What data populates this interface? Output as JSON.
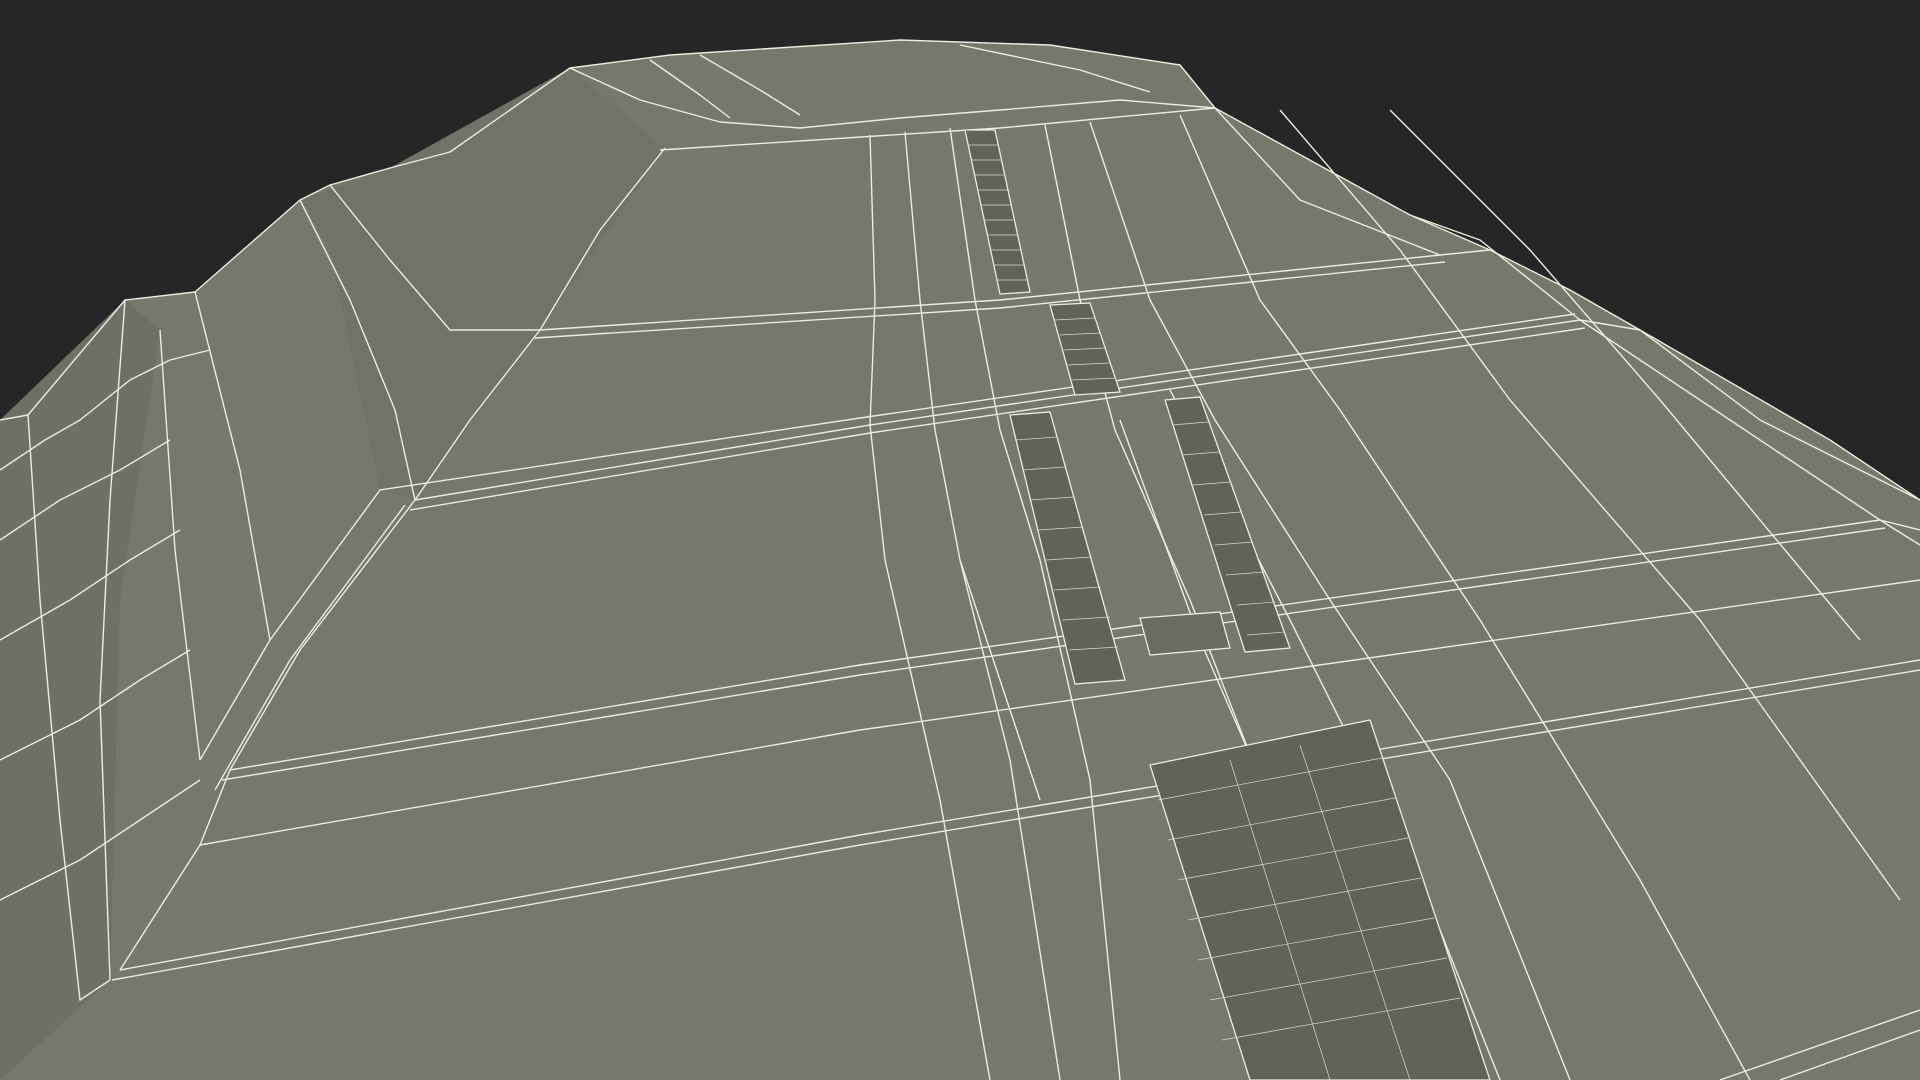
{
  "scene": {
    "subject": "pyramid-wireframe-render",
    "colors": {
      "background": "#262626",
      "surface": "#77776c",
      "surface_shade": "#6d6d63",
      "surface_light": "#7d7d72",
      "wire": "#ecece0",
      "stair_fill": "#62625a"
    }
  }
}
